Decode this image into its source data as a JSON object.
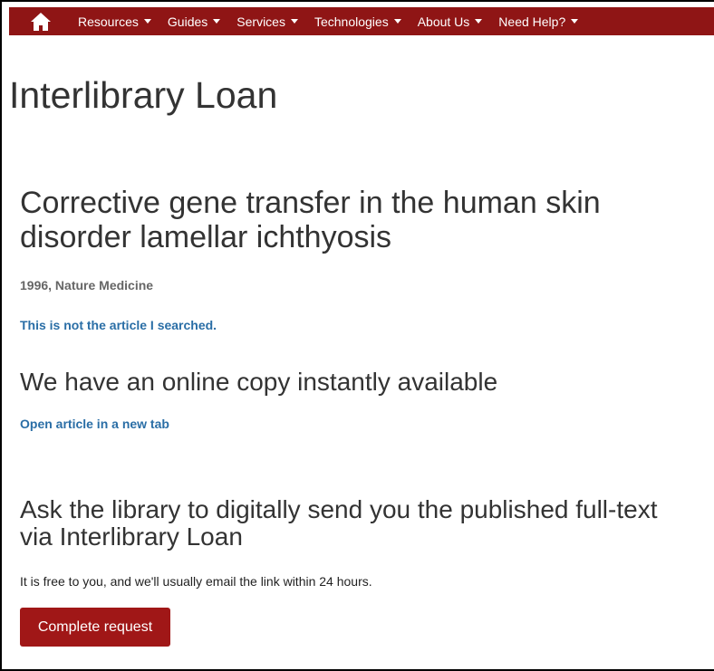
{
  "nav": {
    "home_icon": "house-icon",
    "items": [
      {
        "label": "Resources"
      },
      {
        "label": "Guides"
      },
      {
        "label": "Services"
      },
      {
        "label": "Technologies"
      },
      {
        "label": "About Us"
      },
      {
        "label": "Need Help?"
      }
    ]
  },
  "page": {
    "title": "Interlibrary Loan"
  },
  "article": {
    "title": "Corrective gene transfer in the human skin disorder lamellar ichthyosis",
    "meta": "1996, Nature Medicine",
    "not_article_link": "This is not the article I searched."
  },
  "online": {
    "heading": "We have an online copy instantly available",
    "open_link": "Open article in a new tab"
  },
  "request": {
    "heading": "Ask the library to digitally send you the published full-text via Interlibrary Loan",
    "note": "It is free to you, and we'll usually email the link within 24 hours.",
    "button_label": "Complete request"
  },
  "colors": {
    "nav_bg": "#8f1515",
    "button_bg": "#a01717",
    "link": "#2a6ea6"
  }
}
